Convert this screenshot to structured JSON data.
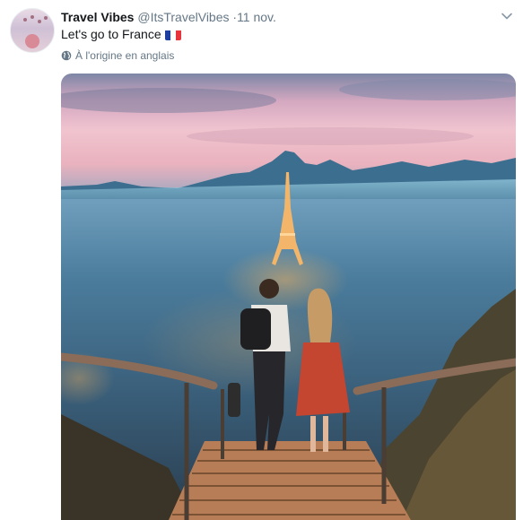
{
  "tweet": {
    "display_name": "Travel Vibes",
    "handle": "@ItsTravelVibes",
    "separator": "·",
    "date": "11 nov.",
    "text": "Let's go to France",
    "flag_colors": [
      "#1f3fa0",
      "#ffffff",
      "#e8353d"
    ],
    "translate_label": "À l'origine en anglais"
  },
  "icons": {
    "avatar": "profile-avatar",
    "menu": "chevron-down-icon",
    "translate": "globe-icon",
    "flag": "france-flag-emoji"
  },
  "photo": {
    "subject": "couple-on-stairs-overlooking-eiffel-tower"
  },
  "colors": {
    "text_primary": "#14171a",
    "text_secondary": "#657786"
  }
}
